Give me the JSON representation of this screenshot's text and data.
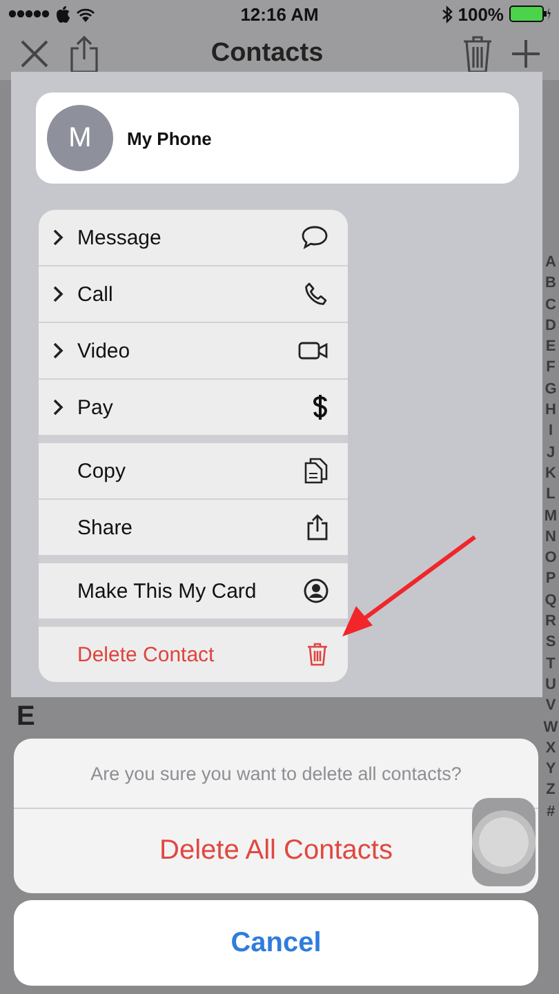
{
  "status_bar": {
    "time": "12:16 AM",
    "battery": "100%"
  },
  "nav_bar": {
    "title": "Contacts"
  },
  "list": {
    "section": "E"
  },
  "index": [
    "A",
    "B",
    "C",
    "D",
    "E",
    "F",
    "G",
    "H",
    "I",
    "J",
    "K",
    "L",
    "M",
    "N",
    "O",
    "P",
    "Q",
    "R",
    "S",
    "T",
    "U",
    "V",
    "W",
    "X",
    "Y",
    "Z",
    "#"
  ],
  "contact_card": {
    "initial": "M",
    "name": "My Phone"
  },
  "menu": [
    [
      {
        "label": "Message",
        "kind": "submenu"
      },
      {
        "label": "Call",
        "kind": "submenu"
      },
      {
        "label": "Video",
        "kind": "submenu"
      },
      {
        "label": "Pay",
        "kind": "submenu"
      }
    ],
    [
      {
        "label": "Copy",
        "kind": "action"
      },
      {
        "label": "Share",
        "kind": "action"
      }
    ],
    [
      {
        "label": "Make This My Card",
        "kind": "action"
      }
    ],
    [
      {
        "label": "Delete Contact",
        "kind": "destructive"
      }
    ]
  ],
  "alert": {
    "message": "Are you sure you want to delete all contacts?",
    "actions": [
      {
        "label": "Delete All Contacts",
        "kind": "destructive"
      }
    ],
    "cancel": "Cancel"
  }
}
